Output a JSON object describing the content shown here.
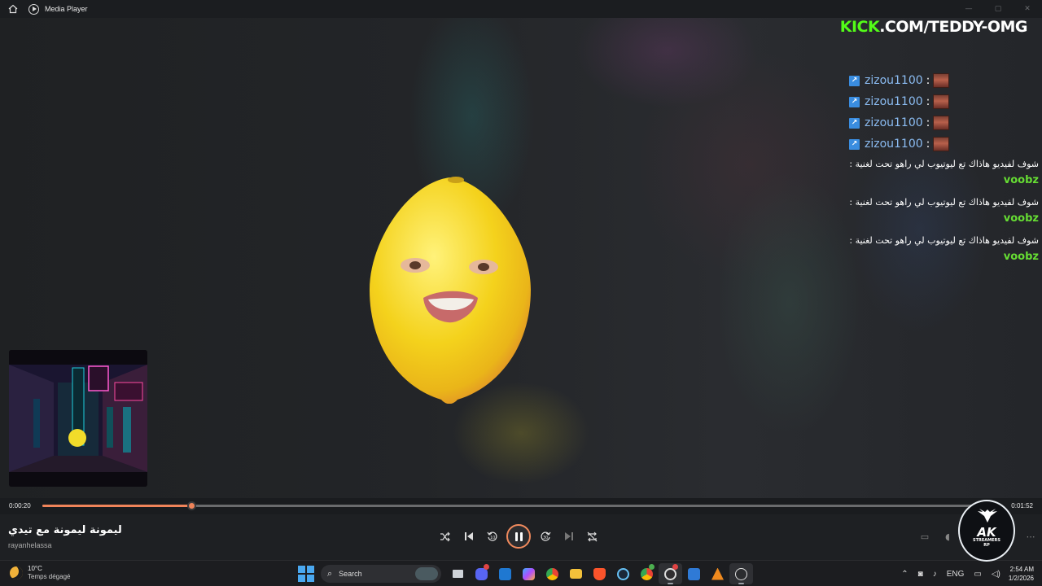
{
  "window": {
    "title": "Media Player",
    "controls": [
      "—",
      "▢",
      "✕"
    ]
  },
  "overlay": {
    "kick_brand": "KICK",
    "kick_path": ".COM/TEDDY-OMG"
  },
  "chat": {
    "repeat_lines": [
      {
        "user": "zizou1100",
        "sep": ":"
      },
      {
        "user": "zizou1100",
        "sep": ":"
      },
      {
        "user": "zizou1100",
        "sep": ":"
      },
      {
        "user": "zizou1100",
        "sep": ":"
      }
    ],
    "messages": [
      {
        "user": "voobz",
        "text": "شوف لفيديو هاذاك تع ليوتيوب لي راهو تحت لغنية",
        "sep": ":"
      },
      {
        "user": "voobz",
        "text": "شوف لفيديو هاذاك تع ليوتيوب لي راهو تحت لغنية",
        "sep": ":"
      },
      {
        "user": "voobz",
        "text": "شوف لفيديو هاذاك تع ليوتيوب لي راهو تحت لغنية",
        "sep": ":"
      }
    ]
  },
  "player": {
    "current_time": "0:00:20",
    "duration": "0:01:52",
    "progress": 0.155,
    "song_title": "ليمونة ليمونة مع تيدي",
    "artist": "rayanhelassa",
    "accent_color": "#f0845a"
  },
  "ak_logo": {
    "main": "AK",
    "line1": "STREAMERS",
    "line2": "RP"
  },
  "taskbar": {
    "weather_temp": "10°C",
    "weather_cond": "Temps dégagé",
    "search_label": "Search",
    "language": "ENG",
    "time": "2:54 AM",
    "date": "1/2/2026"
  }
}
